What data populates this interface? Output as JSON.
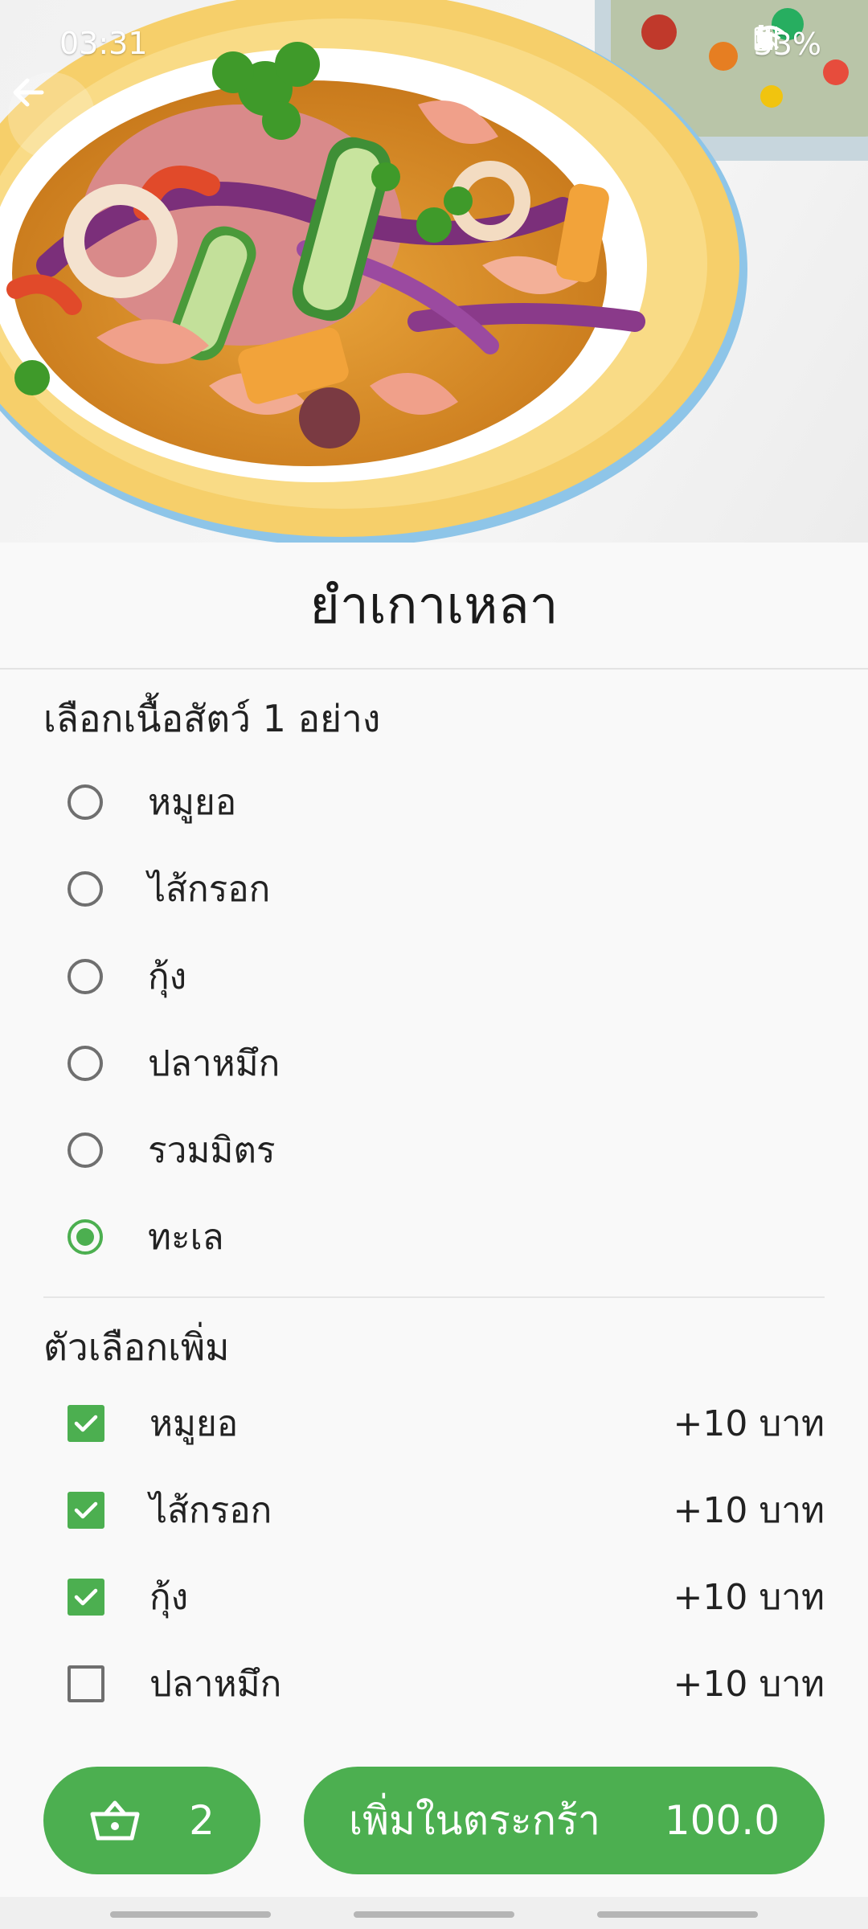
{
  "status_bar": {
    "time": "03:31",
    "battery": "33%",
    "icons": [
      "mute-icon",
      "wifi-icon",
      "signal-icon",
      "battery-icon"
    ]
  },
  "product": {
    "name": "ยำเกาเหลา"
  },
  "meat_section": {
    "title": "เลือกเนื้อสัตว์ 1 อย่าง",
    "options": [
      {
        "label": "หมูยอ",
        "selected": false
      },
      {
        "label": "ไส้กรอก",
        "selected": false
      },
      {
        "label": "กุ้ง",
        "selected": false
      },
      {
        "label": "ปลาหมึก",
        "selected": false
      },
      {
        "label": "รวมมิตร",
        "selected": false
      },
      {
        "label": "ทะเล",
        "selected": true
      }
    ]
  },
  "extras_section": {
    "title": "ตัวเลือกเพิ่ม",
    "options": [
      {
        "label": "หมูยอ",
        "price": "+10 บาท",
        "checked": true
      },
      {
        "label": "ไส้กรอก",
        "price": "+10 บาท",
        "checked": true
      },
      {
        "label": "กุ้ง",
        "price": "+10 บาท",
        "checked": true
      },
      {
        "label": "ปลาหมึก",
        "price": "+10 บาท",
        "checked": false
      }
    ]
  },
  "bottom_bar": {
    "cart_count": "2",
    "add_label": "เพิ่มในตระกร้า",
    "total": "100.0"
  },
  "colors": {
    "accent": "#4caf50",
    "radio_off": "#6f6f6f",
    "background": "#f9f9f9"
  }
}
